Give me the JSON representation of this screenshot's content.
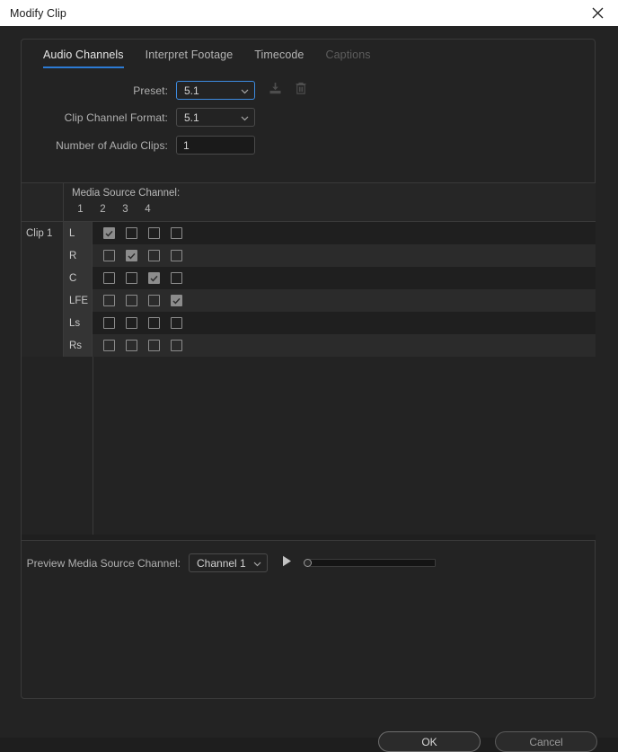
{
  "window": {
    "title": "Modify Clip",
    "close_icon": "close-icon"
  },
  "tabs": [
    {
      "label": "Audio Channels",
      "state": "active"
    },
    {
      "label": "Interpret Footage",
      "state": "normal"
    },
    {
      "label": "Timecode",
      "state": "normal"
    },
    {
      "label": "Captions",
      "state": "disabled"
    }
  ],
  "form": {
    "preset": {
      "label": "Preset:",
      "value": "5.1",
      "focused": true,
      "options": [
        "5.1"
      ]
    },
    "save_preset_icon": "save-preset-icon",
    "delete_preset_icon": "trash-icon",
    "clip_channel_format": {
      "label": "Clip Channel Format:",
      "value": "5.1",
      "options": [
        "5.1"
      ]
    },
    "number_of_audio_clips": {
      "label": "Number of Audio Clips:",
      "value": "1"
    }
  },
  "table": {
    "source_header": "Media Source Channel:",
    "channel_numbers": [
      "1",
      "2",
      "3",
      "4"
    ],
    "clip_label": "Clip 1",
    "rows": [
      {
        "name": "L",
        "checks": [
          true,
          false,
          false,
          false
        ]
      },
      {
        "name": "R",
        "checks": [
          false,
          true,
          false,
          false
        ]
      },
      {
        "name": "C",
        "checks": [
          false,
          false,
          true,
          false
        ]
      },
      {
        "name": "LFE",
        "checks": [
          false,
          false,
          false,
          true
        ]
      },
      {
        "name": "Ls",
        "checks": [
          false,
          false,
          false,
          false
        ]
      },
      {
        "name": "Rs",
        "checks": [
          false,
          false,
          false,
          false
        ]
      }
    ]
  },
  "preview": {
    "label": "Preview Media Source Channel:",
    "channel": {
      "value": "Channel 1",
      "options": [
        "Channel 1"
      ]
    },
    "play_icon": "play-icon",
    "slider_value": 0
  },
  "footer": {
    "ok": "OK",
    "cancel": "Cancel"
  },
  "colors": {
    "accent": "#2c7bd4",
    "focus_border": "#3d8be0",
    "dialog_bg": "#232323",
    "titlebar_bg": "#ffffff"
  }
}
